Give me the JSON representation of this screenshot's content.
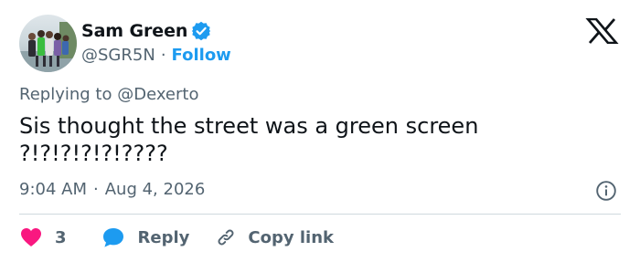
{
  "author": {
    "name": "Sam Green",
    "handle": "@SGR5N",
    "separator": "·",
    "follow_label": "Follow"
  },
  "reply_context": {
    "prefix": "Replying to",
    "mention": "@Dexerto"
  },
  "tweet": {
    "line1": "Sis thought the street was a green screen",
    "line2": "?!?!?!?!?!????",
    "time": "9:04 AM",
    "separator": "·",
    "date": "Aug 4, 2026"
  },
  "actions": {
    "like_count": "3",
    "reply_label": "Reply",
    "copy_link_label": "Copy link"
  },
  "colors": {
    "accent": "#1d9bf0",
    "like": "#f91880",
    "text": "#0f1419",
    "muted": "#536471"
  },
  "icons": {
    "verified": "verified-badge-icon",
    "brand": "x-logo-icon",
    "info": "info-icon",
    "like": "heart-icon",
    "reply": "chat-bubble-icon",
    "copy": "link-icon"
  }
}
